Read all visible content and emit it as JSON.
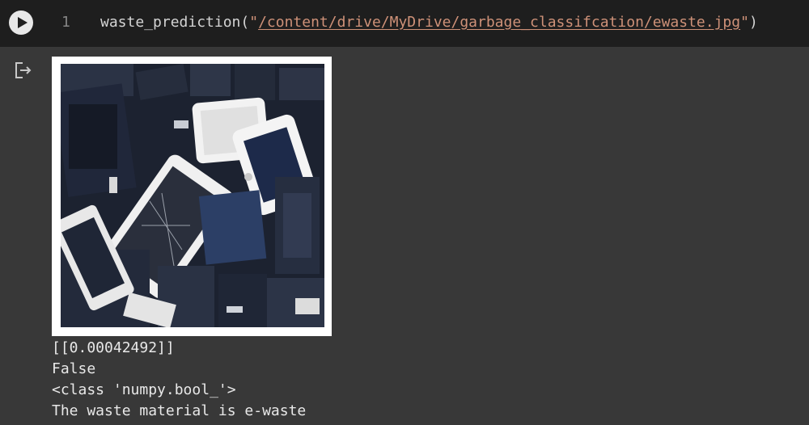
{
  "cell": {
    "line_number": "1",
    "code_prefix": "waste_prediction(",
    "code_quote_open": "\"",
    "code_path": "/content/drive/MyDrive/garbage_classifcation/ewaste.jpg",
    "code_quote_close": "\"",
    "code_suffix": ")",
    "run_icon": "play-icon"
  },
  "output": {
    "icon": "output-exit-icon",
    "image_alt_icon": "e-waste-phones-image",
    "lines": [
      "[[0.00042492]]",
      "False",
      "<class 'numpy.bool_'>",
      "The waste material is e-waste"
    ]
  },
  "colors": {
    "editor_bg": "#1e1e1e",
    "output_bg": "#383838",
    "string": "#ce9178",
    "text": "#d4d4d4"
  }
}
